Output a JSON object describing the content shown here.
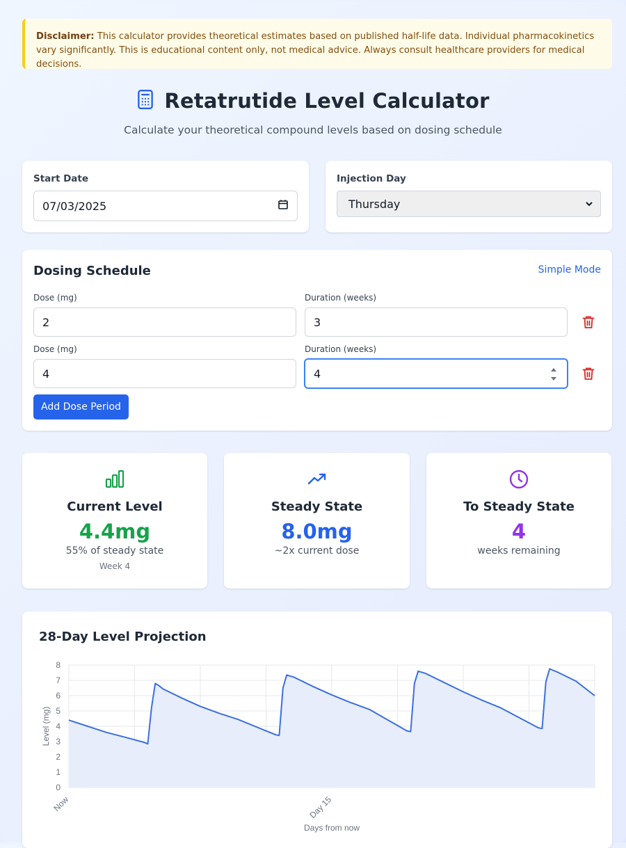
{
  "disclaimer": {
    "label": "Disclaimer:",
    "text": "This calculator provides theoretical estimates based on published half-life data. Individual pharmacokinetics vary significantly. This is educational content only, not medical advice. Always consult healthcare providers for medical decisions."
  },
  "header": {
    "icon": "calculator-icon",
    "title": "Retatrutide Level Calculator",
    "subtitle": "Calculate your theoretical compound levels based on dosing schedule"
  },
  "settings": {
    "start_date_label": "Start Date",
    "start_date_value": "07/03/2025",
    "injection_day_label": "Injection Day",
    "injection_day_value": "Thursday"
  },
  "schedule": {
    "title": "Dosing Schedule",
    "mode_link": "Simple Mode",
    "dose_label": "Dose (mg)",
    "duration_label": "Duration (weeks)",
    "rows": [
      {
        "dose": "2",
        "duration": "3"
      },
      {
        "dose": "4",
        "duration": "4"
      }
    ],
    "add_button": "Add Dose Period"
  },
  "stats": [
    {
      "icon": "bar-chart-icon",
      "title": "Current Level",
      "value": "4.4mg",
      "sub": "55% of steady state",
      "note": "Week 4",
      "color": "#16a34a"
    },
    {
      "icon": "trending-up-icon",
      "title": "Steady State",
      "value": "8.0mg",
      "sub": "~2x current dose",
      "note": "",
      "color": "#2563eb"
    },
    {
      "icon": "clock-icon",
      "title": "To Steady State",
      "value": "4",
      "sub": "weeks remaining",
      "note": "",
      "color": "#9333ea"
    }
  ],
  "chart_title": "28-Day Level Projection",
  "chart_data": {
    "type": "area",
    "title": "28-Day Level Projection",
    "xlabel": "Days from now",
    "ylabel": "Level (mg)",
    "ylim": [
      0,
      8
    ],
    "yticks": [
      0,
      1,
      2,
      3,
      4,
      5,
      6,
      7,
      8
    ],
    "xlim": [
      0,
      28
    ],
    "xtick_labels": [
      {
        "day": 0,
        "label": "Now"
      },
      {
        "day": 14,
        "label": "Day 15"
      }
    ],
    "grid": true,
    "line_color": "#3b6fe0",
    "fill_color": "#e7edfb",
    "series": [
      {
        "x": [
          0,
          1,
          2,
          3,
          4,
          4.2,
          4.4,
          4.6,
          4.8,
          5,
          6,
          7,
          8,
          9,
          11,
          11.2,
          11.4,
          11.6,
          12,
          13,
          14,
          15,
          16,
          18,
          18.2,
          18.4,
          18.6,
          19,
          20,
          21,
          22,
          23,
          25,
          25.2,
          25.4,
          25.6,
          26,
          27,
          28
        ],
        "y": [
          4.4,
          4.0,
          3.6,
          3.28,
          2.95,
          2.85,
          5.2,
          6.8,
          6.65,
          6.45,
          5.85,
          5.3,
          4.85,
          4.45,
          3.45,
          3.4,
          6.5,
          7.35,
          7.2,
          6.6,
          6.05,
          5.55,
          5.1,
          3.7,
          3.65,
          6.8,
          7.6,
          7.45,
          6.85,
          6.25,
          5.7,
          5.2,
          3.9,
          3.85,
          6.9,
          7.75,
          7.55,
          6.95,
          6.0
        ]
      }
    ]
  }
}
